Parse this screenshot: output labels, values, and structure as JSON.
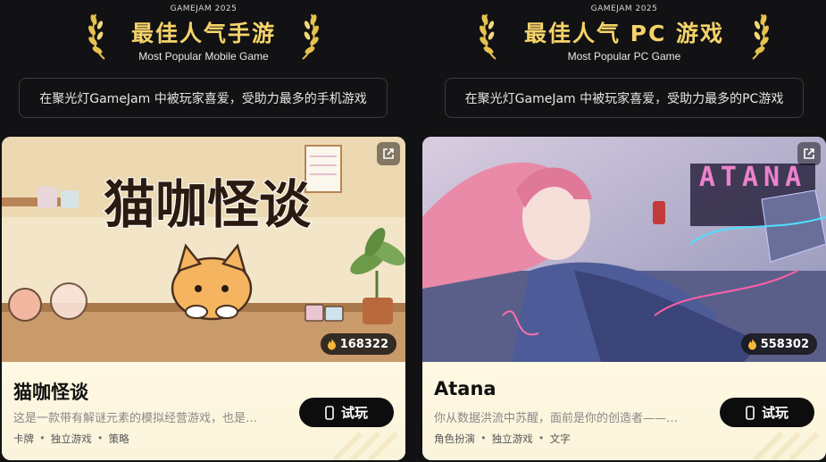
{
  "awards": [
    {
      "jam_label": "GAMEJAM 2025",
      "title": "最佳人气手游",
      "subtitle": "Most Popular Mobile Game",
      "description": "在聚光灯GameJam 中被玩家喜爱，受助力最多的手机游戏",
      "game": {
        "name": "猫咖怪谈",
        "cover_text": "猫咖怪谈",
        "heat": "168322",
        "desc": "这是一款带有解谜元素的模拟经营游戏，也是…",
        "tags": [
          "卡牌",
          "独立游戏",
          "策略"
        ],
        "play_label": "试玩"
      }
    },
    {
      "jam_label": "GAMEJAM 2025",
      "title": "最佳人气 PC 游戏",
      "subtitle": "Most Popular PC Game",
      "description": "在聚光灯GameJam 中被玩家喜爱，受助力最多的PC游戏",
      "game": {
        "name": "Atana",
        "cover_text": "ATANA",
        "heat": "558302",
        "desc": "你从数据洪流中苏醒，面前是你的创造者——…",
        "tags": [
          "角色扮演",
          "独立游戏",
          "文字"
        ],
        "play_label": "试玩"
      }
    }
  ],
  "colors": {
    "gold": "#f5d36a",
    "background": "#121214",
    "card_bg": "#fdf5e0"
  },
  "icons": {
    "laurel": "laurel-icon",
    "external": "external-link-icon",
    "fire": "fire-icon",
    "phone": "phone-icon"
  }
}
